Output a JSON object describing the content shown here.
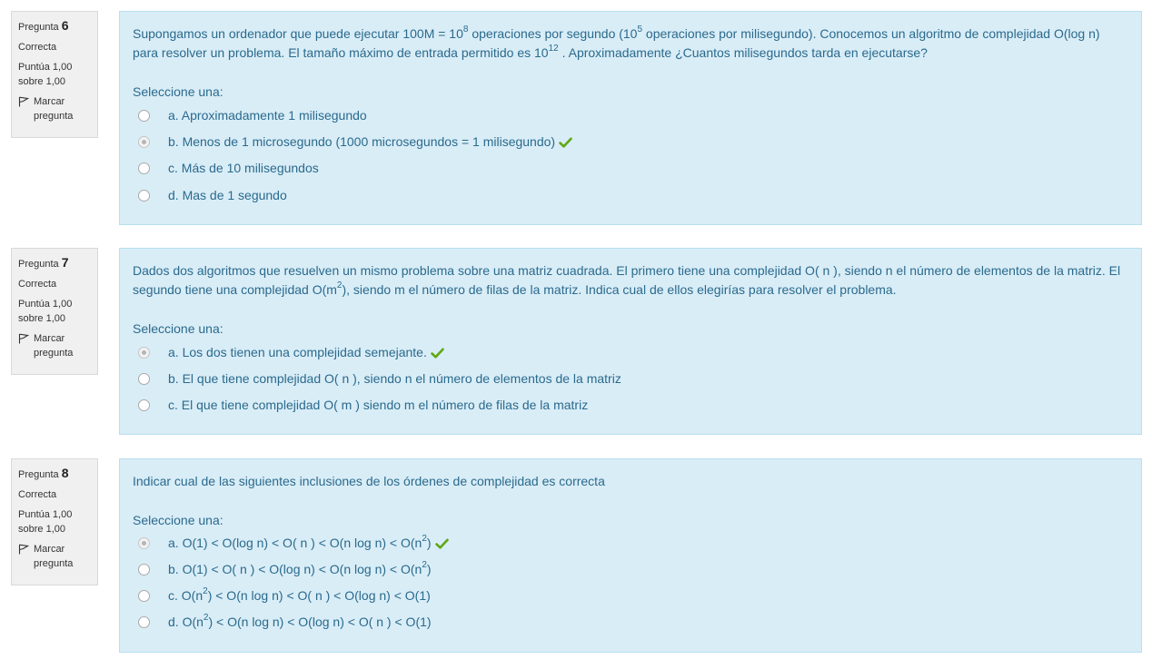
{
  "labels": {
    "pregunta": "Pregunta",
    "state": "Correcta",
    "grade": "Puntúa 1,00 sobre 1,00",
    "flag": "Marcar pregunta",
    "prompt": "Seleccione una:"
  },
  "accent_color": "#5fa916",
  "questions": [
    {
      "number": "6",
      "text": {
        "t1": "Supongamos un ordenador que puede ejecutar 100M = 10",
        "s1": "8",
        "t2": " operaciones por segundo (10",
        "s2": "5",
        "t3": " operaciones por milisegundo). Conocemos un algoritmo de complejidad O(log n) para resolver un problema. El tamaño máximo de entrada permitido es 10",
        "s3": "12",
        "t4": " . Aproximadamente ¿Cuantos milisegundos tarda en ejecutarse?"
      },
      "options": [
        {
          "label": "a. Aproximadamente 1 milisegundo",
          "selected": false,
          "correct": false
        },
        {
          "label": "b. Menos de 1 microsegundo (1000 microsegundos = 1 milisegundo)",
          "selected": true,
          "correct": true
        },
        {
          "label": "c. Más de 10 milisegundos",
          "selected": false,
          "correct": false
        },
        {
          "label": "d. Mas de 1 segundo",
          "selected": false,
          "correct": false
        }
      ]
    },
    {
      "number": "7",
      "text": {
        "t1": "Dados dos algoritmos que resuelven un mismo problema sobre una matriz cuadrada. El primero tiene una complejidad O( n ), siendo n el número de elementos de la matriz. El segundo tiene una complejidad O(m",
        "s1": "2",
        "t2": "), siendo m el número de filas de la matriz. Indica cual de ellos elegirías para resolver el problema."
      },
      "options": [
        {
          "label": "a. Los dos tienen una complejidad semejante.",
          "selected": true,
          "correct": true
        },
        {
          "label": "b. El que tiene complejidad O( n ), siendo n el número de elementos de la matriz",
          "selected": false,
          "correct": false
        },
        {
          "label": "c. El que tiene complejidad O( m ) siendo m el número de filas de la matriz",
          "selected": false,
          "correct": false
        }
      ]
    },
    {
      "number": "8",
      "text": {
        "t1": "Indicar cual de las siguientes inclusiones de los órdenes de complejidad es correcta"
      },
      "options": [
        {
          "pre": "a. O(1) < O(log n) < O( n ) < O(n log n) < O(n",
          "sup": "2",
          "post": ")",
          "selected": true,
          "correct": true
        },
        {
          "pre": "b. O(1) < O( n ) < O(log n) < O(n log n) < O(n",
          "sup": "2",
          "post": ")",
          "selected": false,
          "correct": false
        },
        {
          "pre": "c. O(n",
          "sup": "2",
          "post": ") < O(n log n) < O( n ) < O(log n) < O(1)",
          "selected": false,
          "correct": false
        },
        {
          "pre": "d. O(n",
          "sup": "2",
          "post": ") < O(n log n) < O(log n) < O( n ) < O(1)",
          "selected": false,
          "correct": false
        }
      ]
    }
  ]
}
